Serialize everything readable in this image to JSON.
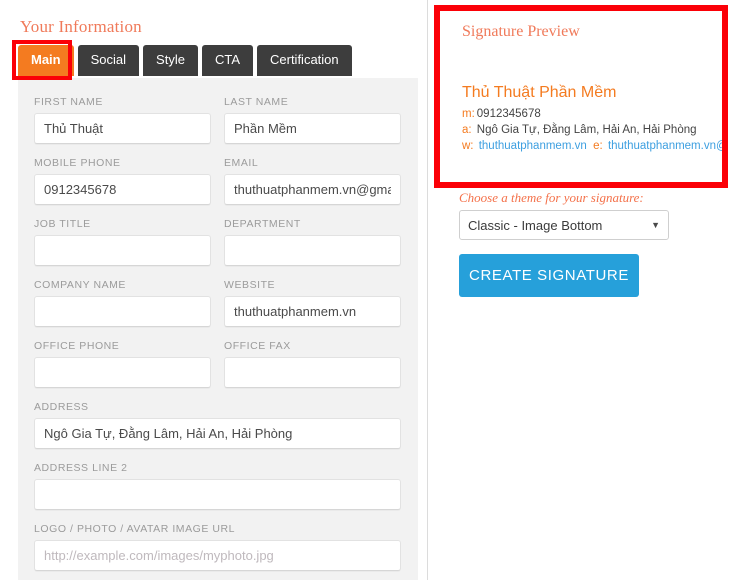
{
  "left": {
    "panel_title": "Your Information",
    "tabs": [
      {
        "label": "Main",
        "active": true
      },
      {
        "label": "Social",
        "active": false
      },
      {
        "label": "Style",
        "active": false
      },
      {
        "label": "CTA",
        "active": false
      },
      {
        "label": "Certification",
        "active": false
      }
    ],
    "fields": {
      "first_name": {
        "label": "FIRST NAME",
        "value": "Thủ Thuật",
        "placeholder": ""
      },
      "last_name": {
        "label": "LAST NAME",
        "value": "Phần Mềm",
        "placeholder": ""
      },
      "mobile_phone": {
        "label": "MOBILE PHONE",
        "value": "0912345678",
        "placeholder": ""
      },
      "email": {
        "label": "EMAIL",
        "value": "thuthuatphanmem.vn@gmail.com",
        "placeholder": ""
      },
      "job_title": {
        "label": "JOB TITLE",
        "value": "",
        "placeholder": ""
      },
      "department": {
        "label": "DEPARTMENT",
        "value": "",
        "placeholder": ""
      },
      "company_name": {
        "label": "COMPANY NAME",
        "value": "",
        "placeholder": ""
      },
      "website": {
        "label": "WEBSITE",
        "value": "thuthuatphanmem.vn",
        "placeholder": ""
      },
      "office_phone": {
        "label": "OFFICE PHONE",
        "value": "",
        "placeholder": ""
      },
      "office_fax": {
        "label": "OFFICE FAX",
        "value": "",
        "placeholder": ""
      },
      "address": {
        "label": "ADDRESS",
        "value": "Ngô Gia Tự, Đằng Lâm, Hải An, Hải Phòng",
        "placeholder": ""
      },
      "address_line_2": {
        "label": "ADDRESS LINE 2",
        "value": "",
        "placeholder": ""
      },
      "logo_url": {
        "label": "LOGO / PHOTO / AVATAR IMAGE URL",
        "value": "",
        "placeholder": "http://example.com/images/myphoto.jpg"
      }
    }
  },
  "right": {
    "preview_title": "Signature Preview",
    "signature": {
      "name": "Thủ Thuật Phần Mềm",
      "mobile_key": "m:",
      "mobile_value": "0912345678",
      "address_key": "a:",
      "address_value": "Ngô Gia Tự, Đằng Lâm, Hải An, Hải Phòng",
      "web_key": "w:",
      "web_value": "thuthuatphanmem.vn",
      "email_key": "e:",
      "email_value": "thuthuatphanmem.vn@gmail.com"
    },
    "theme_label": "Choose a theme for your signature:",
    "theme_selected": "Classic - Image Bottom",
    "theme_caret": "▼",
    "create_button": "CREATE SIGNATURE"
  },
  "colors": {
    "accent_orange": "#f47b20",
    "heading_salmon": "#f07a5a",
    "highlight_red": "#fb0007",
    "tab_dark": "#3d3d3d",
    "button_blue": "#26a0da",
    "link_blue": "#3d9fe0",
    "panel_gray": "#f2f2f2"
  }
}
